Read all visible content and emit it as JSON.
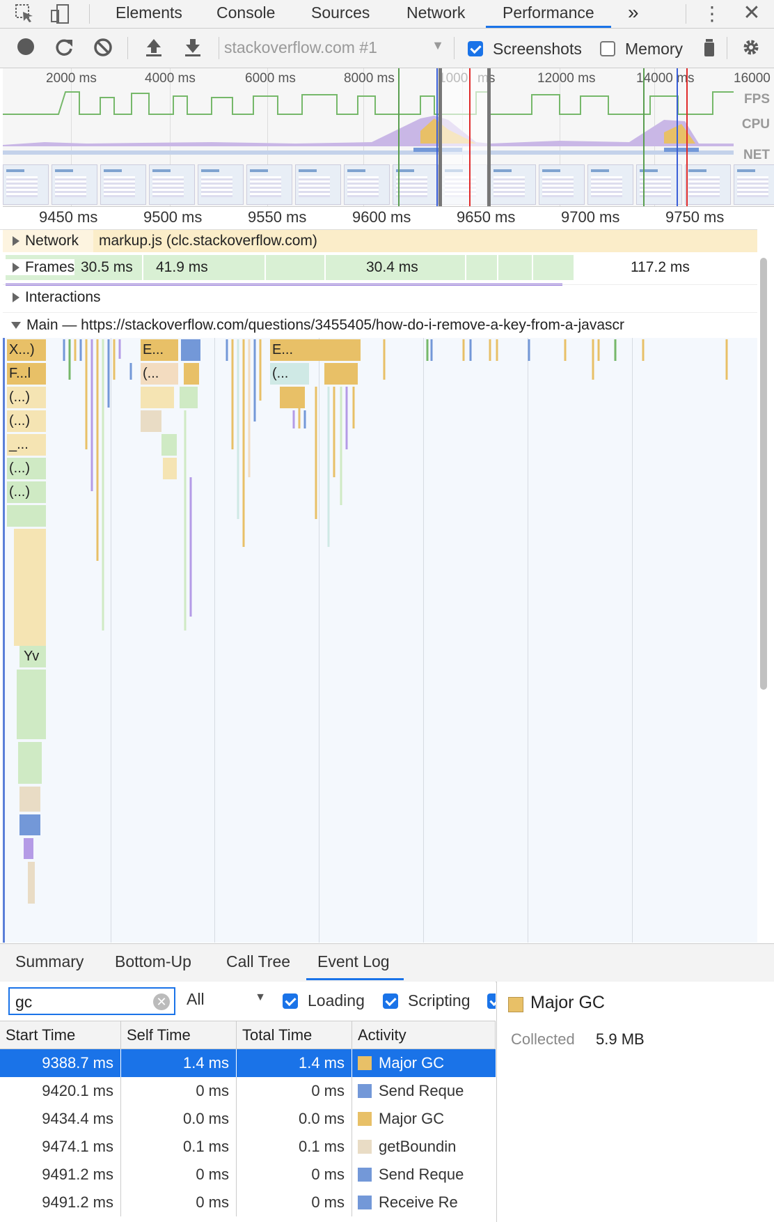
{
  "tabs": [
    "Elements",
    "Console",
    "Sources",
    "Network",
    "Performance"
  ],
  "active_tab": "Performance",
  "more_tabs": "»",
  "toolbar": {
    "profile_select": "stackoverflow.com #1",
    "screenshots_label": "Screenshots",
    "memory_label": "Memory",
    "screenshots_checked": true,
    "memory_checked": false
  },
  "overview": {
    "ticks": [
      "2000 ms",
      "4000 ms",
      "6000 ms",
      "8000 ms",
      "1000",
      "ms",
      "12000 ms",
      "14000 ms",
      "16000"
    ],
    "lane_labels": {
      "fps": "FPS",
      "cpu": "CPU",
      "net": "NET"
    }
  },
  "ruler": [
    "9450 ms",
    "9500 ms",
    "9550 ms",
    "9600 ms",
    "9650 ms",
    "9700 ms",
    "9750 ms"
  ],
  "tracks": {
    "network_label": "Network",
    "network_event": "markup.js (clc.stackoverflow.com)",
    "frames_label": "Frames",
    "frame_times": [
      "30.5 ms",
      "41.9 ms",
      "30.4 ms",
      "117.2 ms"
    ],
    "interactions_label": "Interactions",
    "main_label": "Main — https://stackoverflow.com/questions/3455405/how-do-i-remove-a-key-from-a-javascr"
  },
  "flame_labels": [
    "X...)",
    "F...l",
    "(...)",
    "(...)",
    "_...",
    "(...)",
    "(...)",
    "Yv",
    "E...",
    "(...",
    "E...",
    "(..."
  ],
  "bottom_tabs": [
    "Summary",
    "Bottom-Up",
    "Call Tree",
    "Event Log"
  ],
  "active_bottom_tab": "Event Log",
  "filter": {
    "search_value": "gc",
    "level_select": "All",
    "loading_label": "Loading",
    "scripting_label": "Scripting"
  },
  "table": {
    "headers": [
      "Start Time",
      "Self Time",
      "Total Time",
      "Activity"
    ],
    "rows": [
      {
        "start": "9388.7 ms",
        "self": "1.4 ms",
        "total": "1.4 ms",
        "activity": "Major GC",
        "color": "#e8c067",
        "selected": true
      },
      {
        "start": "9420.1 ms",
        "self": "0 ms",
        "total": "0 ms",
        "activity": "Send Reque",
        "color": "#7398d8",
        "selected": false
      },
      {
        "start": "9434.4 ms",
        "self": "0.0 ms",
        "total": "0.0 ms",
        "activity": "Major GC",
        "color": "#e8c067",
        "selected": false
      },
      {
        "start": "9474.1 ms",
        "self": "0.1 ms",
        "total": "0.1 ms",
        "activity": "getBoundin",
        "color": "#e9dcc5",
        "selected": false
      },
      {
        "start": "9491.2 ms",
        "self": "0 ms",
        "total": "0 ms",
        "activity": "Send Reque",
        "color": "#7398d8",
        "selected": false
      },
      {
        "start": "9491.2 ms",
        "self": "0 ms",
        "total": "0 ms",
        "activity": "Receive Re",
        "color": "#7398d8",
        "selected": false
      }
    ]
  },
  "details": {
    "title": "Major GC",
    "swatch_color": "#e8c067",
    "field_label": "Collected",
    "field_value": "5.9 MB"
  }
}
